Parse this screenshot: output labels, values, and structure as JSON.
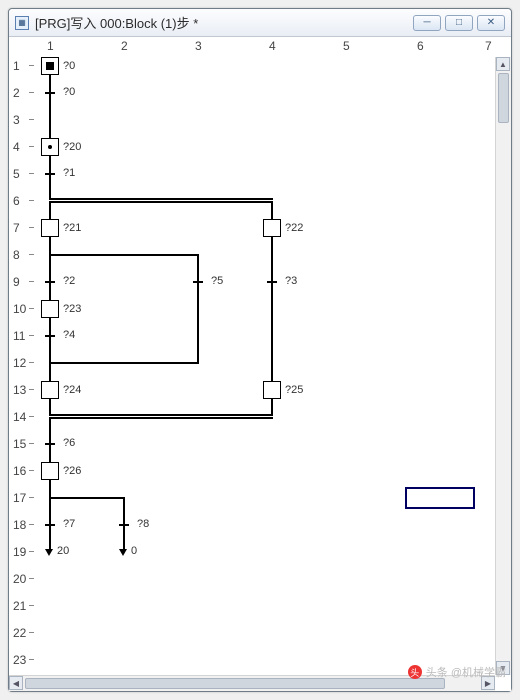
{
  "window": {
    "title": "[PRG]写入 000:Block (1)步 *",
    "icon_glyph": "▦",
    "min_glyph": "─",
    "max_glyph": "□",
    "close_glyph": "✕"
  },
  "ruler": {
    "cols": [
      "1",
      "2",
      "3",
      "4",
      "5",
      "6",
      "7"
    ],
    "rows": [
      "1",
      "2",
      "3",
      "4",
      "5",
      "6",
      "7",
      "8",
      "9",
      "10",
      "11",
      "12",
      "13",
      "14",
      "15",
      "16",
      "17",
      "18",
      "19",
      "20",
      "21",
      "22",
      "23"
    ]
  },
  "labels": {
    "s_q0": "?0",
    "t_q0": "?0",
    "s_q20": "?20",
    "t_q1": "?1",
    "s_q21": "?21",
    "s_q22": "?22",
    "t_q2": "?2",
    "t_q5": "?5",
    "t_q3": "?3",
    "s_q23": "?23",
    "t_q4": "?4",
    "s_q24": "?24",
    "s_q25": "?25",
    "t_q6": "?6",
    "s_q26": "?26",
    "t_q7": "?7",
    "t_q8": "?8",
    "j_20": "20",
    "j_0": "0"
  },
  "scroll": {
    "up": "▲",
    "down": "▼",
    "left": "◀",
    "right": "▶"
  },
  "watermark": {
    "logo": "头",
    "text": "头条 @机械学霸"
  }
}
